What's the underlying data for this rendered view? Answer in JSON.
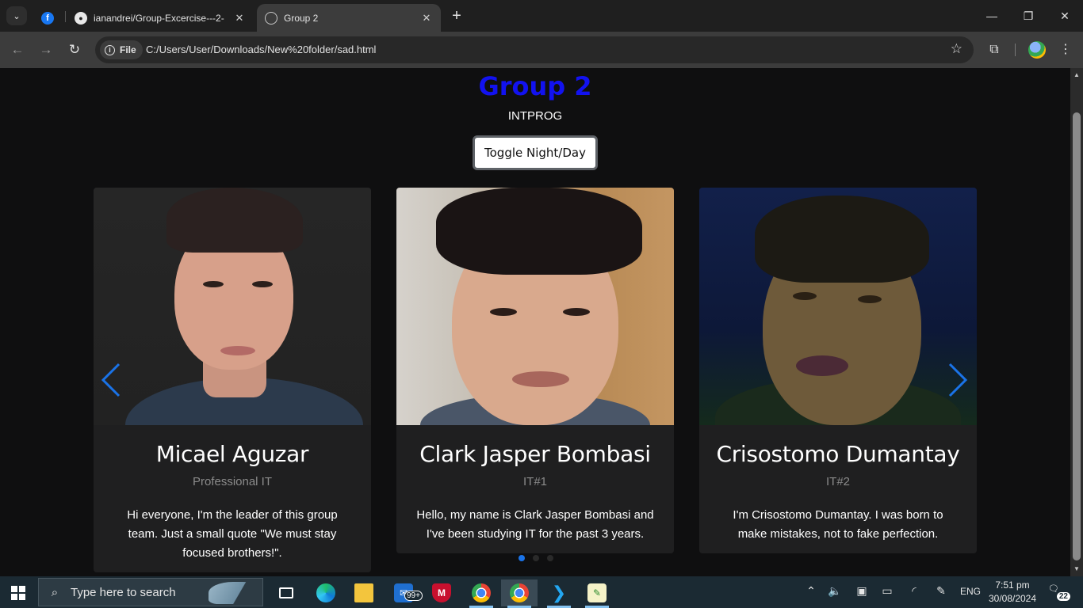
{
  "browser": {
    "tabs": [
      {
        "title": "",
        "favicon": "facebook-icon"
      },
      {
        "title": "ianandrei/Group-Excercise---2-",
        "favicon": "github-icon"
      },
      {
        "title": "Group 2",
        "favicon": "globe-icon",
        "active": true
      }
    ],
    "site_chip_label": "File",
    "url": "C:/Users/User/Downloads/New%20folder/sad.html"
  },
  "page": {
    "title": "Group 2",
    "subtitle": "INTPROG",
    "toggle_label": "Toggle Night/Day",
    "title_color": "#1212f0",
    "cards": [
      {
        "name": "Micael Aguzar",
        "role": "Professional IT",
        "text": "Hi everyone, I'm the leader of this group team. Just a small quote \"We must stay focused brothers!\"."
      },
      {
        "name": "Clark Jasper Bombasi",
        "role": "IT#1",
        "text": "Hello, my name is Clark Jasper Bombasi and I've been studying IT for the past 3 years."
      },
      {
        "name": "Crisostomo Dumantay",
        "role": "IT#2",
        "text": "I'm Crisostomo Dumantay. I was born to make mistakes, not to fake perfection."
      }
    ],
    "carousel": {
      "slide_count": 3,
      "active_index": 0,
      "indicator_color": "#1a73e8"
    }
  },
  "taskbar": {
    "search_placeholder": "Type here to search",
    "mail_badge": "99+",
    "language": "ENG",
    "time": "7:51 pm",
    "date": "30/08/2024",
    "notification_count": "22"
  }
}
